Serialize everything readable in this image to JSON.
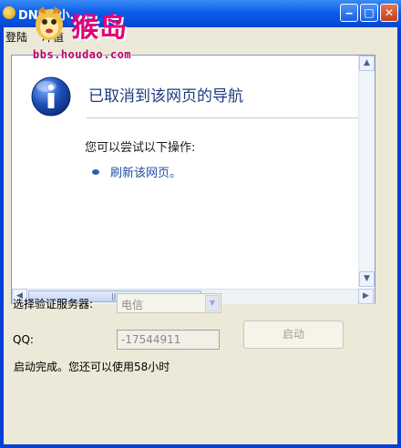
{
  "window": {
    "title": "DNF小小...",
    "controls": {
      "minimize": "‒",
      "maximize": "□",
      "close": "✕"
    }
  },
  "watermark": {
    "logo_text": "猴岛",
    "url": "bbs.houdao.com"
  },
  "menubar": {
    "items": [
      {
        "label": "登陆"
      },
      {
        "label": "冲值"
      }
    ]
  },
  "browser": {
    "heading": "已取消到该网页的导航",
    "subtext": "您可以尝试以下操作:",
    "actions": [
      {
        "label": "刷新该网页。"
      }
    ],
    "info_icon": "info-icon"
  },
  "form": {
    "server_label": "选择验证服务器:",
    "server_value": "电信",
    "qq_label": "QQ:",
    "qq_value": "-17544911",
    "start_label": "启动",
    "status_text": "启动完成。您还可以使用58小时"
  },
  "colors": {
    "titlebar": "#0a5de8",
    "heading": "#1c3b82",
    "link": "#1f4ea4",
    "client_bg": "#ece9d8"
  }
}
